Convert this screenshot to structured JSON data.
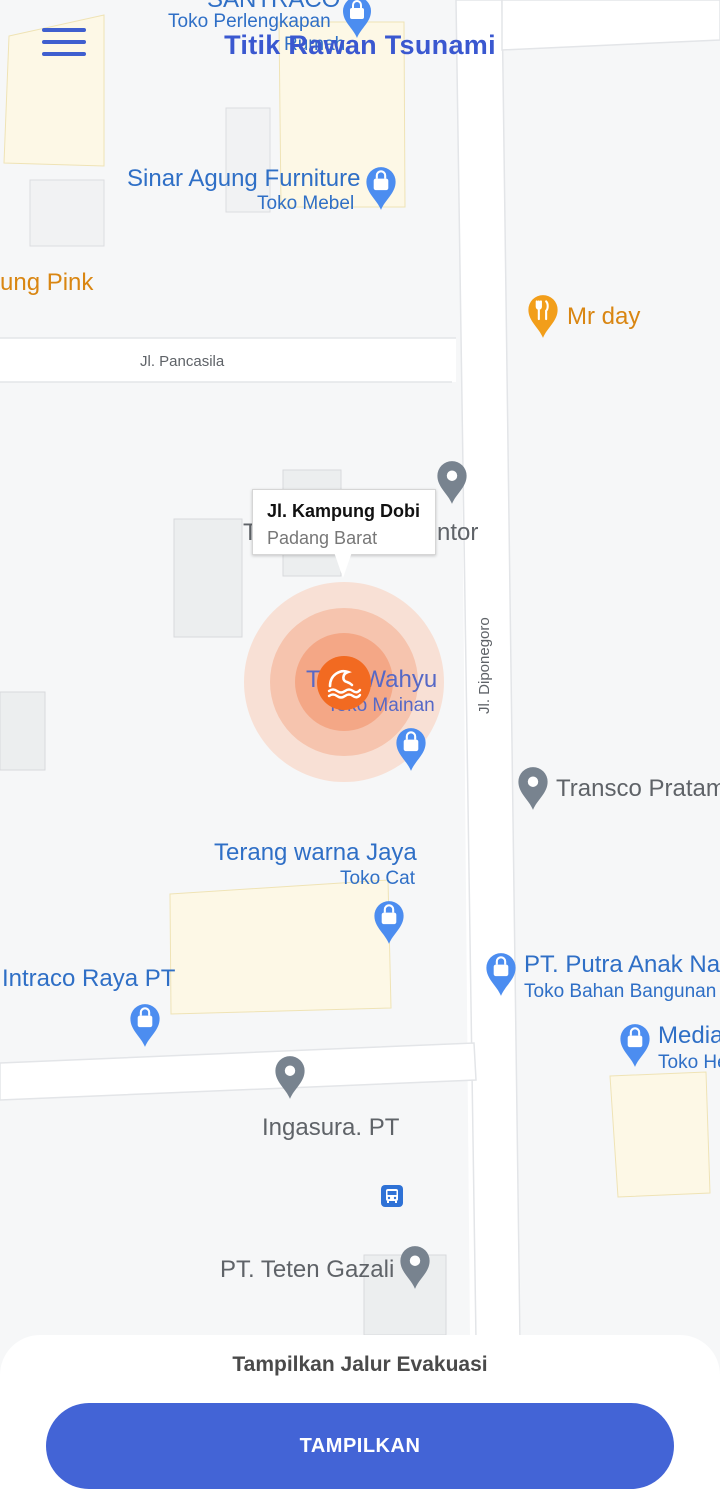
{
  "app": {
    "title": "Titik Rawan Tsunami",
    "menu_icon": "hamburger-menu-icon"
  },
  "map": {
    "streets": {
      "pancasila": "Jl. Pancasila",
      "diponegoro": "Jl. Diponegoro"
    },
    "places": {
      "santraco_name": "SANTRACO",
      "santraco_type": "Toko Perlengkapan",
      "santraco_extra": "Rumah",
      "sinar_name": "Sinar Agung Furniture",
      "sinar_type": "Toko Mebel",
      "pink_name": "ung Pink",
      "mrday_name": "Mr day",
      "toko_pre": "T",
      "toko_post": "ntor",
      "wahyu_name": "Toko Wahyu",
      "wahyu_type": "Toko Mainan",
      "transco_name": "Transco Pratam",
      "terang_name": "Terang warna Jaya",
      "terang_type": "Toko Cat",
      "intraco_name": "Intraco Raya PT",
      "putra_name": "PT. Putra Anak Nag",
      "putra_type": "Toko Bahan Bangunan",
      "media_name": "Media",
      "media_type": "Toko He",
      "ingasura_name": "Ingasura. PT",
      "teten_name": "PT. Teten Gazali"
    },
    "selected": {
      "title": "Jl. Kampung Dobi",
      "subtitle": "Padang Barat",
      "marker_icon": "tsunami-wave-icon"
    },
    "colors": {
      "accent": "#4364d6",
      "marker": "#f26a21",
      "poi_blue": "#2f6fc6",
      "poi_orange": "#d98612"
    }
  },
  "sheet": {
    "title": "Tampilkan Jalur Evakuasi",
    "button_label": "TAMPILKAN"
  }
}
